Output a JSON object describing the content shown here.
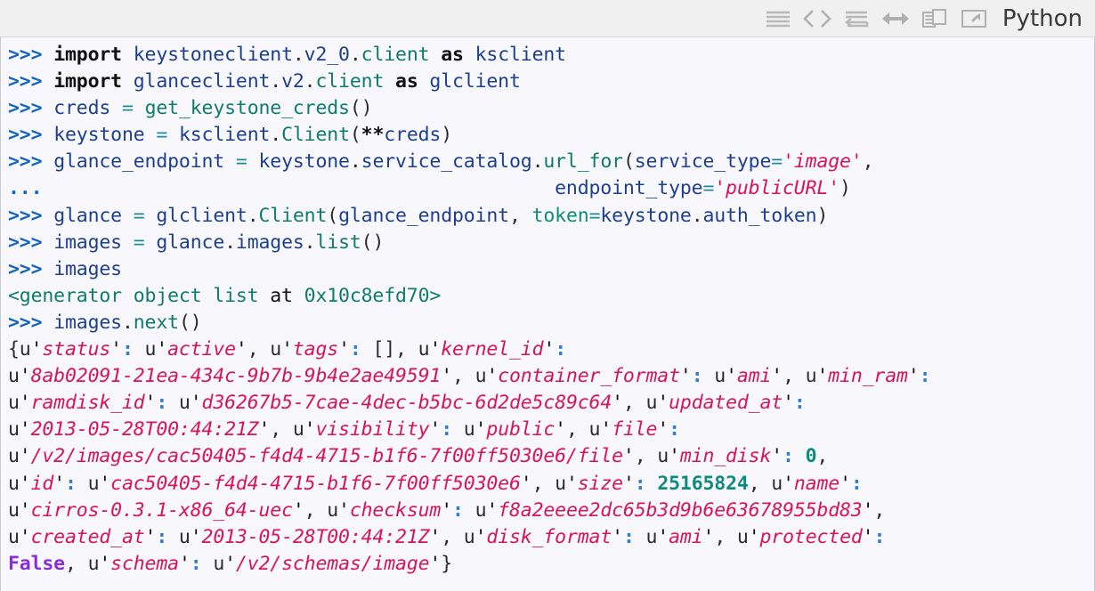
{
  "toolbar": {
    "icons": [
      {
        "name": "lines-icon",
        "label": "wrap-lines"
      },
      {
        "name": "code-brackets-icon",
        "label": "code"
      },
      {
        "name": "exchange-icon",
        "label": "exchange"
      },
      {
        "name": "arrows-h-icon",
        "label": "resize-horizontal"
      },
      {
        "name": "copy-icon",
        "label": "copy"
      },
      {
        "name": "popout-icon",
        "label": "open-external"
      }
    ],
    "language_label": "Python"
  },
  "theme": {
    "background": "#f8f8fc",
    "toolbar_background": "#f0f0f0",
    "prompt_color": "#1565c0",
    "string_color": "#d6145a",
    "number_color": "#0f8a7e",
    "name_color": "#1d3f8f",
    "attr_color": "#0f7b6c",
    "bool_color": "#8a2be2",
    "text_color": "#101010"
  },
  "console": {
    "prompt": ">>>",
    "continuation": "...",
    "lines": [
      {
        "type": "input",
        "text": ">>> import keystoneclient.v2_0.client as ksclient"
      },
      {
        "type": "input",
        "text": ">>> import glanceclient.v2.client as glclient"
      },
      {
        "type": "input",
        "text": ">>> creds = get_keystone_creds()"
      },
      {
        "type": "input",
        "text": ">>> keystone = ksclient.Client(**creds)"
      },
      {
        "type": "input",
        "text": ">>> glance_endpoint = keystone.service_catalog.url_for(service_type='image',"
      },
      {
        "type": "cont",
        "text": "...                                             endpoint_type='publicURL')"
      },
      {
        "type": "input",
        "text": ">>> glance = glclient.Client(glance_endpoint, token=keystone.auth_token)"
      },
      {
        "type": "input",
        "text": ">>> images = glance.images.list()"
      },
      {
        "type": "input",
        "text": ">>> images"
      },
      {
        "type": "output",
        "text": "<generator object list at 0x10c8efd70>"
      },
      {
        "type": "input",
        "text": ">>> images.next()"
      },
      {
        "type": "output",
        "text": "{u'status': u'active', u'tags': [], u'kernel_id':"
      },
      {
        "type": "output",
        "text": "u'8ab02091-21ea-434c-9b7b-9b4e2ae49591', u'container_format': u'ami', u'min_ram'"
      },
      {
        "type": "output",
        "text": "u'ramdisk_id': u'd36267b5-7cae-4dec-b5bc-6d2de5c89c64', u'updated_at':"
      },
      {
        "type": "output",
        "text": "u'2013-05-28T00:44:21Z', u'visibility': u'public', u'file':"
      },
      {
        "type": "output",
        "text": "u'/v2/images/cac50405-f4d4-4715-b1f6-7f00ff5030e6/file', u'min_disk': 0,"
      },
      {
        "type": "output",
        "text": "u'id': u'cac50405-f4d4-4715-b1f6-7f00ff5030e6', u'size': 25165824, u'name':"
      },
      {
        "type": "output",
        "text": "u'cirros-0.3.1-x86_64-uec', u'checksum': u'f8a2eeee2dc65b3d9b6e63678955bd83',"
      },
      {
        "type": "output",
        "text": "u'created_at': u'2013-05-28T00:44:21Z', u'disk_format': u'ami', u'protected':"
      },
      {
        "type": "output",
        "text": "False, u'schema': u'/v2/schemas/image'}"
      }
    ],
    "rendered": [
      [
        [
          "t-prompt",
          ">>>"
        ],
        [
          "t-plain",
          " "
        ],
        [
          "t-kw",
          "import"
        ],
        [
          "t-plain",
          " "
        ],
        [
          "t-name",
          "keystoneclient"
        ],
        [
          "t-punct",
          "."
        ],
        [
          "t-name",
          "v2_0"
        ],
        [
          "t-punct",
          "."
        ],
        [
          "t-attr",
          "client"
        ],
        [
          "t-plain",
          " "
        ],
        [
          "t-kw",
          "as"
        ],
        [
          "t-plain",
          " "
        ],
        [
          "t-name",
          "ksclient"
        ]
      ],
      [
        [
          "t-prompt",
          ">>>"
        ],
        [
          "t-plain",
          " "
        ],
        [
          "t-kw",
          "import"
        ],
        [
          "t-plain",
          " "
        ],
        [
          "t-name",
          "glanceclient"
        ],
        [
          "t-punct",
          "."
        ],
        [
          "t-name",
          "v2"
        ],
        [
          "t-punct",
          "."
        ],
        [
          "t-attr",
          "client"
        ],
        [
          "t-plain",
          " "
        ],
        [
          "t-kw",
          "as"
        ],
        [
          "t-plain",
          " "
        ],
        [
          "t-name",
          "glclient"
        ]
      ],
      [
        [
          "t-prompt",
          ">>>"
        ],
        [
          "t-plain",
          " "
        ],
        [
          "t-name",
          "creds"
        ],
        [
          "t-plain",
          " "
        ],
        [
          "t-op",
          "="
        ],
        [
          "t-plain",
          " "
        ],
        [
          "t-attr",
          "get_keystone_creds"
        ],
        [
          "t-punct",
          "()"
        ]
      ],
      [
        [
          "t-prompt",
          ">>>"
        ],
        [
          "t-plain",
          " "
        ],
        [
          "t-name",
          "keystone"
        ],
        [
          "t-plain",
          " "
        ],
        [
          "t-op",
          "="
        ],
        [
          "t-plain",
          " "
        ],
        [
          "t-name",
          "ksclient"
        ],
        [
          "t-punct",
          "."
        ],
        [
          "t-attr",
          "Client"
        ],
        [
          "t-punct",
          "("
        ],
        [
          "t-kw",
          "**"
        ],
        [
          "t-name",
          "creds"
        ],
        [
          "t-punct",
          ")"
        ]
      ],
      [
        [
          "t-prompt",
          ">>>"
        ],
        [
          "t-plain",
          " "
        ],
        [
          "t-name",
          "glance_endpoint"
        ],
        [
          "t-plain",
          " "
        ],
        [
          "t-op",
          "="
        ],
        [
          "t-plain",
          " "
        ],
        [
          "t-name",
          "keystone"
        ],
        [
          "t-punct",
          "."
        ],
        [
          "t-name",
          "service_catalog"
        ],
        [
          "t-punct",
          "."
        ],
        [
          "t-attr",
          "url_for"
        ],
        [
          "t-punct",
          "("
        ],
        [
          "t-name",
          "service_type"
        ],
        [
          "t-op",
          "="
        ],
        [
          "t-str",
          "'image'"
        ],
        [
          "t-punct",
          ","
        ]
      ],
      [
        [
          "t-prompt",
          "..."
        ],
        [
          "t-plain",
          "                                             "
        ],
        [
          "t-name",
          "endpoint_type"
        ],
        [
          "t-op",
          "="
        ],
        [
          "t-str",
          "'publicURL'"
        ],
        [
          "t-punct",
          ")"
        ]
      ],
      [
        [
          "t-prompt",
          ">>>"
        ],
        [
          "t-plain",
          " "
        ],
        [
          "t-name",
          "glance"
        ],
        [
          "t-plain",
          " "
        ],
        [
          "t-op",
          "="
        ],
        [
          "t-plain",
          " "
        ],
        [
          "t-name",
          "glclient"
        ],
        [
          "t-punct",
          "."
        ],
        [
          "t-attr",
          "Client"
        ],
        [
          "t-punct",
          "("
        ],
        [
          "t-name",
          "glance_endpoint"
        ],
        [
          "t-punct",
          ", "
        ],
        [
          "t-kwarg",
          "token"
        ],
        [
          "t-op",
          "="
        ],
        [
          "t-name",
          "keystone"
        ],
        [
          "t-punct",
          "."
        ],
        [
          "t-name",
          "auth_token"
        ],
        [
          "t-punct",
          ")"
        ]
      ],
      [
        [
          "t-prompt",
          ">>>"
        ],
        [
          "t-plain",
          " "
        ],
        [
          "t-name",
          "images"
        ],
        [
          "t-plain",
          " "
        ],
        [
          "t-op",
          "="
        ],
        [
          "t-plain",
          " "
        ],
        [
          "t-name",
          "glance"
        ],
        [
          "t-punct",
          "."
        ],
        [
          "t-name",
          "images"
        ],
        [
          "t-punct",
          "."
        ],
        [
          "t-attr",
          "list"
        ],
        [
          "t-punct",
          "()"
        ]
      ],
      [
        [
          "t-prompt",
          ">>>"
        ],
        [
          "t-plain",
          " "
        ],
        [
          "t-name",
          "images"
        ]
      ],
      [
        [
          "t-out",
          "<generator object list "
        ],
        [
          "t-plain",
          "at"
        ],
        [
          "t-out",
          " 0x10c8efd70>"
        ]
      ],
      [
        [
          "t-prompt",
          ">>>"
        ],
        [
          "t-plain",
          " "
        ],
        [
          "t-name",
          "images"
        ],
        [
          "t-punct",
          "."
        ],
        [
          "t-attr",
          "next"
        ],
        [
          "t-punct",
          "()"
        ]
      ],
      [
        [
          "t-punct",
          "{u"
        ],
        [
          "t-strq",
          "'"
        ],
        [
          "t-str",
          "status"
        ],
        [
          "t-strq",
          "'"
        ],
        [
          "t-colon",
          ":"
        ],
        [
          "t-punct",
          " u"
        ],
        [
          "t-strq",
          "'"
        ],
        [
          "t-str",
          "active"
        ],
        [
          "t-strq",
          "'"
        ],
        [
          "t-punct",
          ", u"
        ],
        [
          "t-strq",
          "'"
        ],
        [
          "t-str",
          "tags"
        ],
        [
          "t-strq",
          "'"
        ],
        [
          "t-colon",
          ":"
        ],
        [
          "t-punct",
          " [], u"
        ],
        [
          "t-strq",
          "'"
        ],
        [
          "t-str",
          "kernel_id"
        ],
        [
          "t-strq",
          "'"
        ],
        [
          "t-colon",
          ":"
        ]
      ],
      [
        [
          "t-punct",
          "u"
        ],
        [
          "t-strq",
          "'"
        ],
        [
          "t-str",
          "8ab02091-21ea-434c-9b7b-9b4e2ae49591"
        ],
        [
          "t-strq",
          "'"
        ],
        [
          "t-punct",
          ", u"
        ],
        [
          "t-strq",
          "'"
        ],
        [
          "t-str",
          "container_format"
        ],
        [
          "t-strq",
          "'"
        ],
        [
          "t-colon",
          ":"
        ],
        [
          "t-punct",
          " u"
        ],
        [
          "t-strq",
          "'"
        ],
        [
          "t-str",
          "ami"
        ],
        [
          "t-strq",
          "'"
        ],
        [
          "t-punct",
          ", u"
        ],
        [
          "t-strq",
          "'"
        ],
        [
          "t-str",
          "min_ram"
        ],
        [
          "t-strq",
          "'"
        ],
        [
          "t-colon",
          ":"
        ]
      ],
      [
        [
          "t-punct",
          "u"
        ],
        [
          "t-strq",
          "'"
        ],
        [
          "t-str",
          "ramdisk_id"
        ],
        [
          "t-strq",
          "'"
        ],
        [
          "t-colon",
          ":"
        ],
        [
          "t-punct",
          " u"
        ],
        [
          "t-strq",
          "'"
        ],
        [
          "t-str",
          "d36267b5-7cae-4dec-b5bc-6d2de5c89c64"
        ],
        [
          "t-strq",
          "'"
        ],
        [
          "t-punct",
          ", u"
        ],
        [
          "t-strq",
          "'"
        ],
        [
          "t-str",
          "updated_at"
        ],
        [
          "t-strq",
          "'"
        ],
        [
          "t-colon",
          ":"
        ]
      ],
      [
        [
          "t-punct",
          "u"
        ],
        [
          "t-strq",
          "'"
        ],
        [
          "t-str",
          "2013-05-28T00:44:21Z"
        ],
        [
          "t-strq",
          "'"
        ],
        [
          "t-punct",
          ", u"
        ],
        [
          "t-strq",
          "'"
        ],
        [
          "t-str",
          "visibility"
        ],
        [
          "t-strq",
          "'"
        ],
        [
          "t-colon",
          ":"
        ],
        [
          "t-punct",
          " u"
        ],
        [
          "t-strq",
          "'"
        ],
        [
          "t-str",
          "public"
        ],
        [
          "t-strq",
          "'"
        ],
        [
          "t-punct",
          ", u"
        ],
        [
          "t-strq",
          "'"
        ],
        [
          "t-str",
          "file"
        ],
        [
          "t-strq",
          "'"
        ],
        [
          "t-colon",
          ":"
        ]
      ],
      [
        [
          "t-punct",
          "u"
        ],
        [
          "t-strq",
          "'"
        ],
        [
          "t-str",
          "/v2/images/cac50405-f4d4-4715-b1f6-7f00ff5030e6/file"
        ],
        [
          "t-strq",
          "'"
        ],
        [
          "t-punct",
          ", u"
        ],
        [
          "t-strq",
          "'"
        ],
        [
          "t-str",
          "min_disk"
        ],
        [
          "t-strq",
          "'"
        ],
        [
          "t-colon",
          ":"
        ],
        [
          "t-punct",
          " "
        ],
        [
          "t-num",
          "0"
        ],
        [
          "t-punct",
          ","
        ]
      ],
      [
        [
          "t-punct",
          "u"
        ],
        [
          "t-strq",
          "'"
        ],
        [
          "t-str",
          "id"
        ],
        [
          "t-strq",
          "'"
        ],
        [
          "t-colon",
          ":"
        ],
        [
          "t-punct",
          " u"
        ],
        [
          "t-strq",
          "'"
        ],
        [
          "t-str",
          "cac50405-f4d4-4715-b1f6-7f00ff5030e6"
        ],
        [
          "t-strq",
          "'"
        ],
        [
          "t-punct",
          ", u"
        ],
        [
          "t-strq",
          "'"
        ],
        [
          "t-str",
          "size"
        ],
        [
          "t-strq",
          "'"
        ],
        [
          "t-colon",
          ":"
        ],
        [
          "t-punct",
          " "
        ],
        [
          "t-num",
          "25165824"
        ],
        [
          "t-punct",
          ", u"
        ],
        [
          "t-strq",
          "'"
        ],
        [
          "t-str",
          "name"
        ],
        [
          "t-strq",
          "'"
        ],
        [
          "t-colon",
          ":"
        ]
      ],
      [
        [
          "t-punct",
          "u"
        ],
        [
          "t-strq",
          "'"
        ],
        [
          "t-str",
          "cirros-0.3.1-x86_64-uec"
        ],
        [
          "t-strq",
          "'"
        ],
        [
          "t-punct",
          ", u"
        ],
        [
          "t-strq",
          "'"
        ],
        [
          "t-str",
          "checksum"
        ],
        [
          "t-strq",
          "'"
        ],
        [
          "t-colon",
          ":"
        ],
        [
          "t-punct",
          " u"
        ],
        [
          "t-strq",
          "'"
        ],
        [
          "t-str",
          "f8a2eeee2dc65b3d9b6e63678955bd83"
        ],
        [
          "t-strq",
          "'"
        ],
        [
          "t-punct",
          ","
        ]
      ],
      [
        [
          "t-punct",
          "u"
        ],
        [
          "t-strq",
          "'"
        ],
        [
          "t-str",
          "created_at"
        ],
        [
          "t-strq",
          "'"
        ],
        [
          "t-colon",
          ":"
        ],
        [
          "t-punct",
          " u"
        ],
        [
          "t-strq",
          "'"
        ],
        [
          "t-str",
          "2013-05-28T00:44:21Z"
        ],
        [
          "t-strq",
          "'"
        ],
        [
          "t-punct",
          ", u"
        ],
        [
          "t-strq",
          "'"
        ],
        [
          "t-str",
          "disk_format"
        ],
        [
          "t-strq",
          "'"
        ],
        [
          "t-colon",
          ":"
        ],
        [
          "t-punct",
          " u"
        ],
        [
          "t-strq",
          "'"
        ],
        [
          "t-str",
          "ami"
        ],
        [
          "t-strq",
          "'"
        ],
        [
          "t-punct",
          ", u"
        ],
        [
          "t-strq",
          "'"
        ],
        [
          "t-str",
          "protected"
        ],
        [
          "t-strq",
          "'"
        ],
        [
          "t-colon",
          ":"
        ]
      ],
      [
        [
          "t-bool",
          "False"
        ],
        [
          "t-punct",
          ", u"
        ],
        [
          "t-strq",
          "'"
        ],
        [
          "t-str",
          "schema"
        ],
        [
          "t-strq",
          "'"
        ],
        [
          "t-colon",
          ":"
        ],
        [
          "t-punct",
          " u"
        ],
        [
          "t-strq",
          "'"
        ],
        [
          "t-str",
          "/v2/schemas/image"
        ],
        [
          "t-strq",
          "'"
        ],
        [
          "t-punct",
          "}"
        ]
      ]
    ]
  }
}
